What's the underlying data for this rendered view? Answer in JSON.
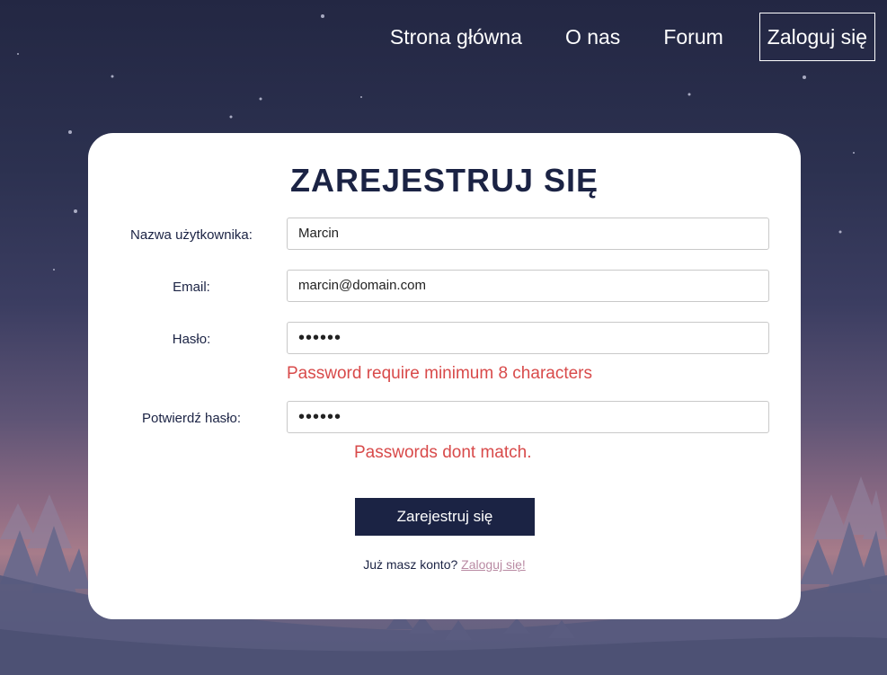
{
  "nav": {
    "items": [
      {
        "label": "Strona główna"
      },
      {
        "label": "O nas"
      },
      {
        "label": "Forum"
      },
      {
        "label": "Zaloguj się"
      }
    ]
  },
  "form": {
    "title": "ZAREJESTRUJ SIĘ",
    "username": {
      "label": "Nazwa użytkownika:",
      "value": "Marcin"
    },
    "email": {
      "label": "Email:",
      "value": "marcin@domain.com"
    },
    "password": {
      "label": "Hasło:",
      "value": "••••••",
      "error": "Password require minimum 8 characters"
    },
    "confirm": {
      "label": "Potwierdź hasło:",
      "value": "••••••",
      "error": "Passwords dont match."
    },
    "submit_label": "Zarejestruj się",
    "footer_text": "Już masz konto?",
    "footer_link": "Zaloguj się!"
  },
  "colors": {
    "primary": "#1b2344",
    "error": "#d84a4a",
    "link": "#b98aa3"
  }
}
